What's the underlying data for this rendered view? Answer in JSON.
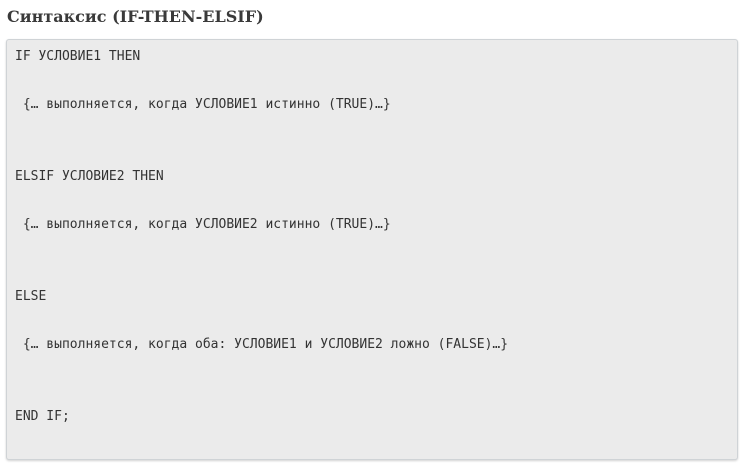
{
  "heading": "Синтаксис (IF-THEN-ELSIF)",
  "code": {
    "lines": [
      "IF УСЛОВИЕ1 THEN",
      " {… выполняется, когда УСЛОВИЕ1 истинно (TRUE)…}",
      "ELSIF УСЛОВИЕ2 THEN",
      " {… выполняется, когда УСЛОВИЕ2 истинно (TRUE)…}",
      "ELSE",
      " {… выполняется, когда оба: УСЛОВИЕ1 и УСЛОВИЕ2 ложно (FALSE)…}",
      "END IF;"
    ]
  },
  "colors": {
    "heading": "#3a3a3a",
    "code_background": "#ebebeb",
    "code_border": "#cfd3d6",
    "code_text": "#333333"
  }
}
